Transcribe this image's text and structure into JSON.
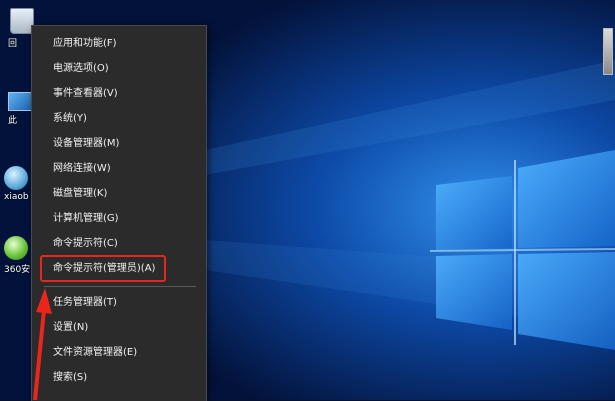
{
  "desktop": {
    "icons": [
      {
        "name": "recycle-bin",
        "label": "回"
      },
      {
        "name": "this-pc",
        "label": "此"
      },
      {
        "name": "xiaobai",
        "label": "xiaob"
      },
      {
        "name": "360",
        "label": "360安"
      }
    ]
  },
  "context_menu": {
    "items": [
      {
        "label": "应用和功能(F)"
      },
      {
        "label": "电源选项(O)"
      },
      {
        "label": "事件查看器(V)"
      },
      {
        "label": "系统(Y)"
      },
      {
        "label": "设备管理器(M)"
      },
      {
        "label": "网络连接(W)"
      },
      {
        "label": "磁盘管理(K)"
      },
      {
        "label": "计算机管理(G)"
      },
      {
        "label": "命令提示符(C)"
      },
      {
        "label": "命令提示符(管理员)(A)"
      },
      {
        "label": "任务管理器(T)"
      },
      {
        "label": "设置(N)"
      },
      {
        "label": "文件资源管理器(E)"
      },
      {
        "label": "搜索(S)"
      }
    ]
  },
  "colors": {
    "menu_bg": "#2b2b2b",
    "menu_text": "#f2f2f2",
    "annotation_red": "#e8261c"
  }
}
